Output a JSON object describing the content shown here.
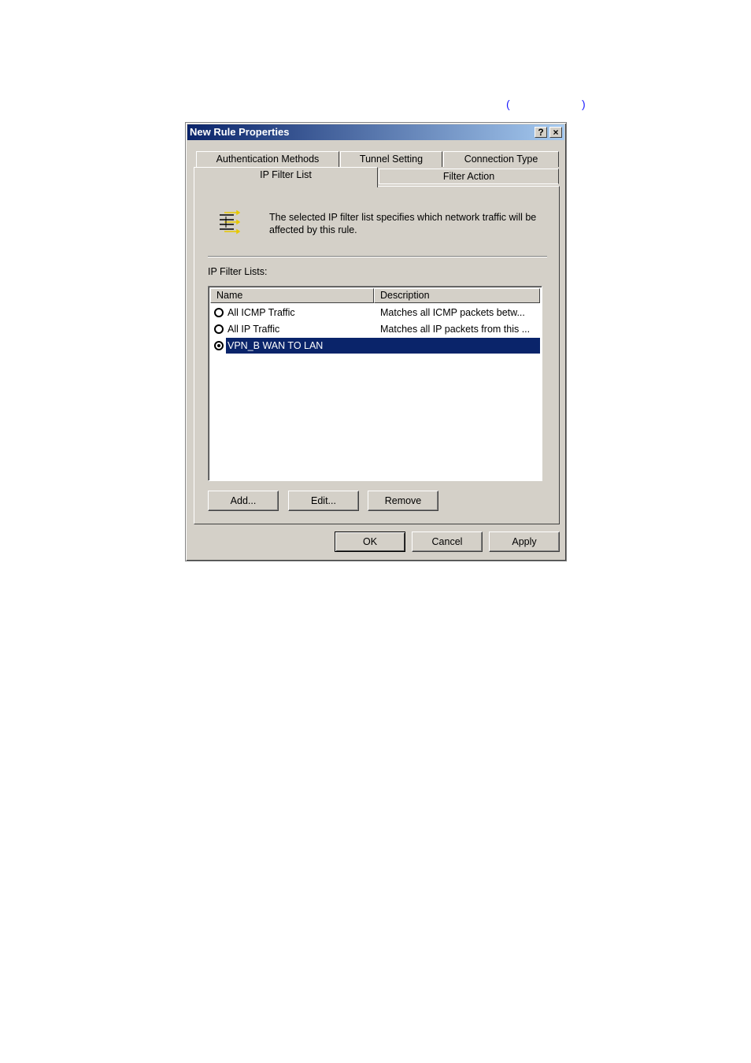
{
  "annotation": {
    "open": "(",
    "close": ")"
  },
  "dialog": {
    "title": "New Rule Properties",
    "help_btn": "?",
    "close_btn": "×"
  },
  "tabs": {
    "back": [
      "Authentication Methods",
      "Tunnel Setting",
      "Connection Type"
    ],
    "front": [
      "IP Filter List",
      "Filter Action"
    ],
    "active": "IP Filter List"
  },
  "panel": {
    "description": "The selected IP filter list specifies which network traffic will be affected by this rule.",
    "list_label": "IP Filter Lists:",
    "columns": [
      "Name",
      "Description"
    ],
    "rows": [
      {
        "name": "All ICMP Traffic",
        "description": "Matches all ICMP packets betw...",
        "selected": false
      },
      {
        "name": "All IP Traffic",
        "description": "Matches all IP packets from this ...",
        "selected": false
      },
      {
        "name": "VPN_B WAN TO LAN",
        "description": "",
        "selected": true
      }
    ],
    "buttons": {
      "add": "Add...",
      "edit": "Edit...",
      "remove": "Remove"
    }
  },
  "footer": {
    "ok": "OK",
    "cancel": "Cancel",
    "apply": "Apply"
  }
}
